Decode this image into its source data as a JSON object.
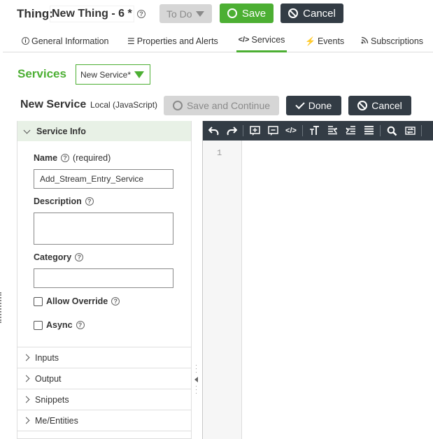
{
  "header": {
    "entity_type": "Thing:",
    "entity_name": "New Thing - 6 *",
    "status": "To Do",
    "save_label": "Save",
    "cancel_label": "Cancel"
  },
  "tabs": [
    {
      "label": "General Information",
      "icon": "info-icon",
      "active": false
    },
    {
      "label": "Properties and Alerts",
      "icon": "list-icon",
      "active": false
    },
    {
      "label": "Services",
      "icon": "code-icon",
      "active": true
    },
    {
      "label": "Events",
      "icon": "lightning-icon",
      "active": false
    },
    {
      "label": "Subscriptions",
      "icon": "rss-icon",
      "active": false
    }
  ],
  "services": {
    "title": "Services",
    "selected": "New Service*"
  },
  "service": {
    "name": "New Service",
    "type": "Local (JavaScript)",
    "save_continue_label": "Save and Continue",
    "done_label": "Done",
    "cancel_label": "Cancel"
  },
  "service_info": {
    "title": "Service Info",
    "name_label": "Name",
    "required_text": "(required)",
    "name_value": "Add_Stream_Entry_Service",
    "description_label": "Description",
    "description_value": "",
    "category_label": "Category",
    "category_value": "",
    "allow_override_label": "Allow Override",
    "async_label": "Async"
  },
  "sections": [
    "Inputs",
    "Output",
    "Snippets",
    "Me/Entities"
  ],
  "editor": {
    "line_numbers": [
      "1"
    ]
  },
  "colors": {
    "accent_green": "#4caf33",
    "dark_button": "#333c45",
    "disabled_button": "#d6d6d6",
    "section_bg": "#e8f1e6"
  }
}
